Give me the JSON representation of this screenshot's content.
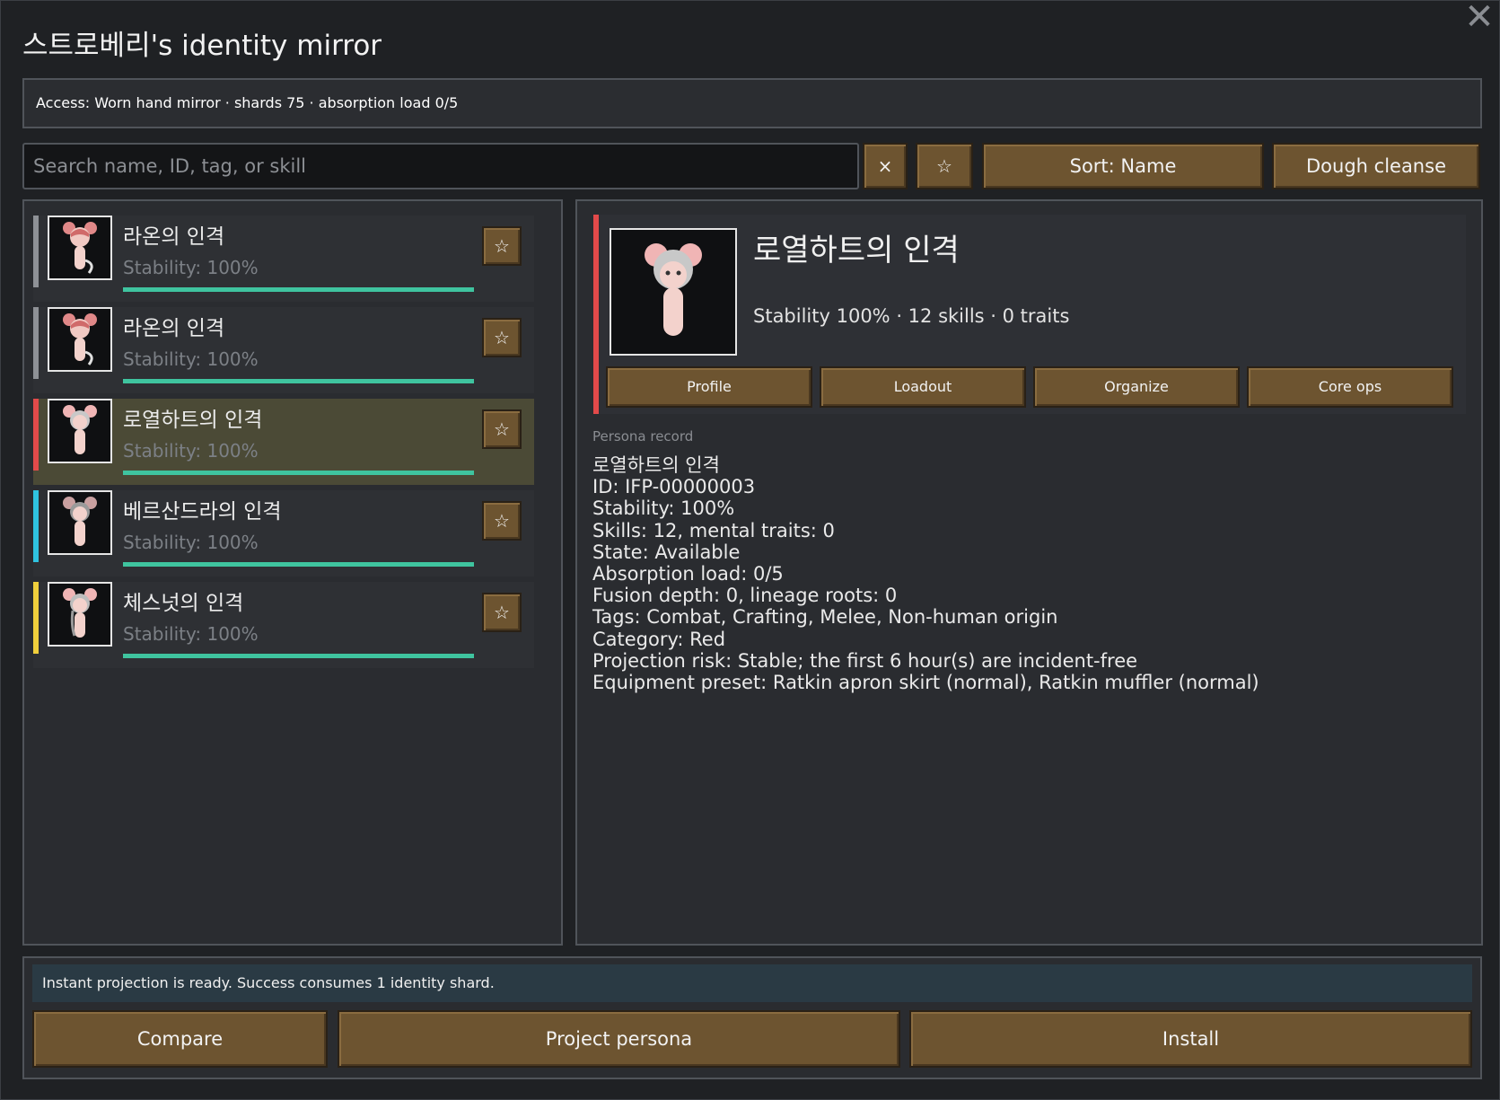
{
  "window": {
    "title": "스트로베리's identity mirror",
    "close_label": "✕"
  },
  "access_line": "Access: Worn hand mirror · shards 75 · absorption load 0/5",
  "toolbar": {
    "search_placeholder": "Search name, ID, tag, or skill",
    "search_value": "",
    "clear_label": "×",
    "favorite_label": "☆",
    "sort_label": "Sort: Name",
    "dough_label": "Dough cleanse"
  },
  "personas": [
    {
      "name": "라온의 인격",
      "stability": "Stability: 100%",
      "stripe_color": "#8e9196",
      "star": "☆",
      "selected": false,
      "stability_fraction": 1.0
    },
    {
      "name": "라온의 인격",
      "stability": "Stability: 100%",
      "stripe_color": "#8e9196",
      "star": "☆",
      "selected": false,
      "stability_fraction": 1.0
    },
    {
      "name": "로열하트의 인격",
      "stability": "Stability: 100%",
      "stripe_color": "#e24a4a",
      "star": "☆",
      "selected": true,
      "stability_fraction": 1.0
    },
    {
      "name": "베르산드라의 인격",
      "stability": "Stability: 100%",
      "stripe_color": "#2fc3e0",
      "star": "☆",
      "selected": false,
      "stability_fraction": 1.0
    },
    {
      "name": "체스넛의 인격",
      "stability": "Stability: 100%",
      "stripe_color": "#f0cf3c",
      "star": "☆",
      "selected": false,
      "stability_fraction": 1.0
    }
  ],
  "detail": {
    "name": "로열하트의 인격",
    "summary": "Stability 100% · 12 skills · 0 traits",
    "tabs": [
      "Profile",
      "Loadout",
      "Organize",
      "Core ops"
    ],
    "record_label": "Persona record",
    "record_lines": [
      "로열하트의 인격",
      "ID: IFP-00000003",
      "Stability: 100%",
      "Skills: 12, mental traits: 0",
      "State: Available",
      "Absorption load: 0/5",
      "Fusion depth: 0, lineage roots: 0",
      "Tags: Combat, Crafting, Melee, Non-human origin",
      "Category: Red",
      "Projection risk: Stable; the first 6 hour(s) are incident-free",
      "Equipment preset: Ratkin apron skirt (normal), Ratkin muffler (normal)"
    ]
  },
  "footer": {
    "notice": "Instant projection is ready. Success consumes 1 identity shard.",
    "compare_label": "Compare",
    "project_label": "Project persona",
    "install_label": "Install"
  },
  "colors": {
    "accent_button": "#6d5430",
    "stability_bar": "#3fc49f",
    "selected_row": "#4b4a36",
    "notice_bg": "#2a3a44"
  }
}
